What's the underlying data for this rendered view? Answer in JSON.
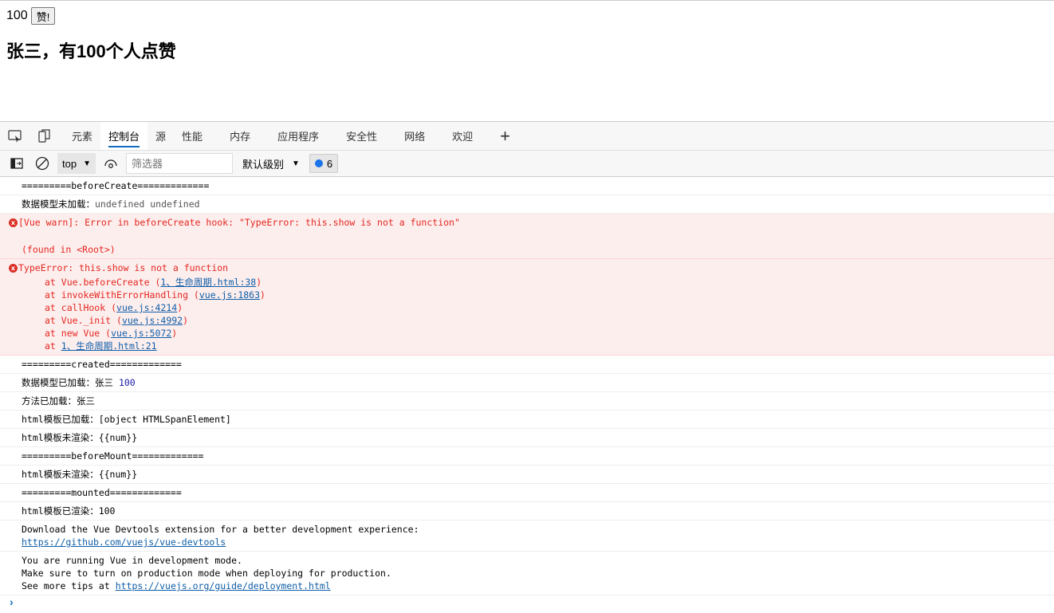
{
  "page": {
    "count": "100",
    "like_button": "赞!",
    "heading": "张三，有100个人点赞"
  },
  "devtools": {
    "tabs": [
      "元素",
      "控制台",
      "源",
      "性能",
      "内存",
      "应用程序",
      "安全性",
      "网络",
      "欢迎"
    ],
    "active_tab": "控制台",
    "context": "top",
    "filter_placeholder": "筛选器",
    "level": "默认级别",
    "message_count": "6"
  },
  "console": [
    {
      "type": "log",
      "lines": [
        [
          [
            "=========beforeCreate=============",
            ""
          ]
        ]
      ]
    },
    {
      "type": "log",
      "lines": [
        [
          [
            "数据模型未加载：",
            ""
          ],
          [
            "undefined undefined",
            "grey"
          ]
        ]
      ]
    },
    {
      "type": "error",
      "expandable": true,
      "lines": [
        [
          [
            "[Vue warn]: Error in beforeCreate hook: \"TypeError: this.show is not a function\"",
            ""
          ]
        ],
        [
          [
            "",
            ""
          ]
        ],
        [
          [
            "(found in <Root>)",
            ""
          ]
        ]
      ]
    },
    {
      "type": "error",
      "expandable": true,
      "lines": [
        [
          [
            "TypeError: this.show is not a function",
            ""
          ]
        ],
        [
          [
            "at Vue.beforeCreate (",
            "i"
          ],
          [
            "1、生命周期.html:38",
            "link"
          ],
          [
            ")",
            ""
          ]
        ],
        [
          [
            "at invokeWithErrorHandling (",
            "i"
          ],
          [
            "vue.js:1863",
            "link"
          ],
          [
            ")",
            ""
          ]
        ],
        [
          [
            "at callHook (",
            "i"
          ],
          [
            "vue.js:4214",
            "link"
          ],
          [
            ")",
            ""
          ]
        ],
        [
          [
            "at Vue._init (",
            "i"
          ],
          [
            "vue.js:4992",
            "link"
          ],
          [
            ")",
            ""
          ]
        ],
        [
          [
            "at new Vue (",
            "i"
          ],
          [
            "vue.js:5072",
            "link"
          ],
          [
            ")",
            ""
          ]
        ],
        [
          [
            "at ",
            "i"
          ],
          [
            "1、生命周期.html:21",
            "link"
          ]
        ]
      ]
    },
    {
      "type": "log",
      "lines": [
        [
          [
            "=========created=============",
            ""
          ]
        ]
      ]
    },
    {
      "type": "log",
      "lines": [
        [
          [
            "数据模型已加载：张三 ",
            ""
          ],
          [
            "100",
            "num"
          ]
        ]
      ]
    },
    {
      "type": "log",
      "lines": [
        [
          [
            "方法已加载：张三",
            ""
          ]
        ]
      ]
    },
    {
      "type": "log",
      "lines": [
        [
          [
            "html模板已加载：[object HTMLSpanElement]",
            ""
          ]
        ]
      ]
    },
    {
      "type": "log",
      "lines": [
        [
          [
            "html模板未渲染：{{num}}",
            ""
          ]
        ]
      ]
    },
    {
      "type": "log",
      "lines": [
        [
          [
            "=========beforeMount=============",
            ""
          ]
        ]
      ]
    },
    {
      "type": "log",
      "lines": [
        [
          [
            "html模板未渲染：{{num}}",
            ""
          ]
        ]
      ]
    },
    {
      "type": "log",
      "lines": [
        [
          [
            "=========mounted=============",
            ""
          ]
        ]
      ]
    },
    {
      "type": "log",
      "lines": [
        [
          [
            "html模板已渲染：100",
            ""
          ]
        ]
      ]
    },
    {
      "type": "log",
      "lines": [
        [
          [
            "Download the Vue Devtools extension for a better development experience:",
            ""
          ]
        ],
        [
          [
            "https://github.com/vuejs/vue-devtools",
            "link"
          ]
        ]
      ]
    },
    {
      "type": "log",
      "lines": [
        [
          [
            "You are running Vue in development mode.",
            ""
          ]
        ],
        [
          [
            "Make sure to turn on production mode when deploying for production.",
            ""
          ]
        ],
        [
          [
            "See more tips at ",
            ""
          ],
          [
            "https://vuejs.org/guide/deployment.html",
            "link"
          ]
        ]
      ]
    }
  ],
  "prompt_symbol": "›"
}
